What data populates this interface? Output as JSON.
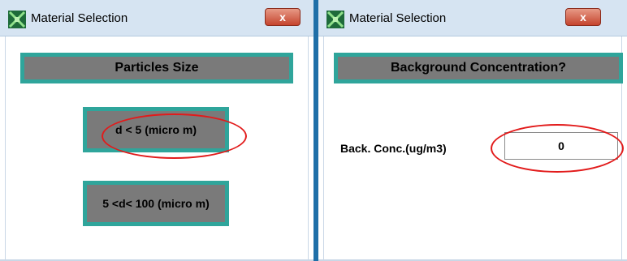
{
  "window_left": {
    "title": "Material Selection",
    "close_glyph": "x",
    "heading": "Particles Size",
    "options": [
      {
        "label": "d < 5 (micro m)"
      },
      {
        "label": "5 <d< 100 (micro m)"
      }
    ]
  },
  "window_right": {
    "title": "Material Selection",
    "close_glyph": "x",
    "heading": "Background Concentration?",
    "field_label": "Back. Conc.(ug/m3)",
    "field_value": "0"
  },
  "colors": {
    "accent_teal": "#2fa59b",
    "button_gray": "#7a7a7a",
    "highlight_red": "#e21b1b",
    "close_red": "#c5442e"
  },
  "icons": [
    "app-icon",
    "close-icon"
  ]
}
